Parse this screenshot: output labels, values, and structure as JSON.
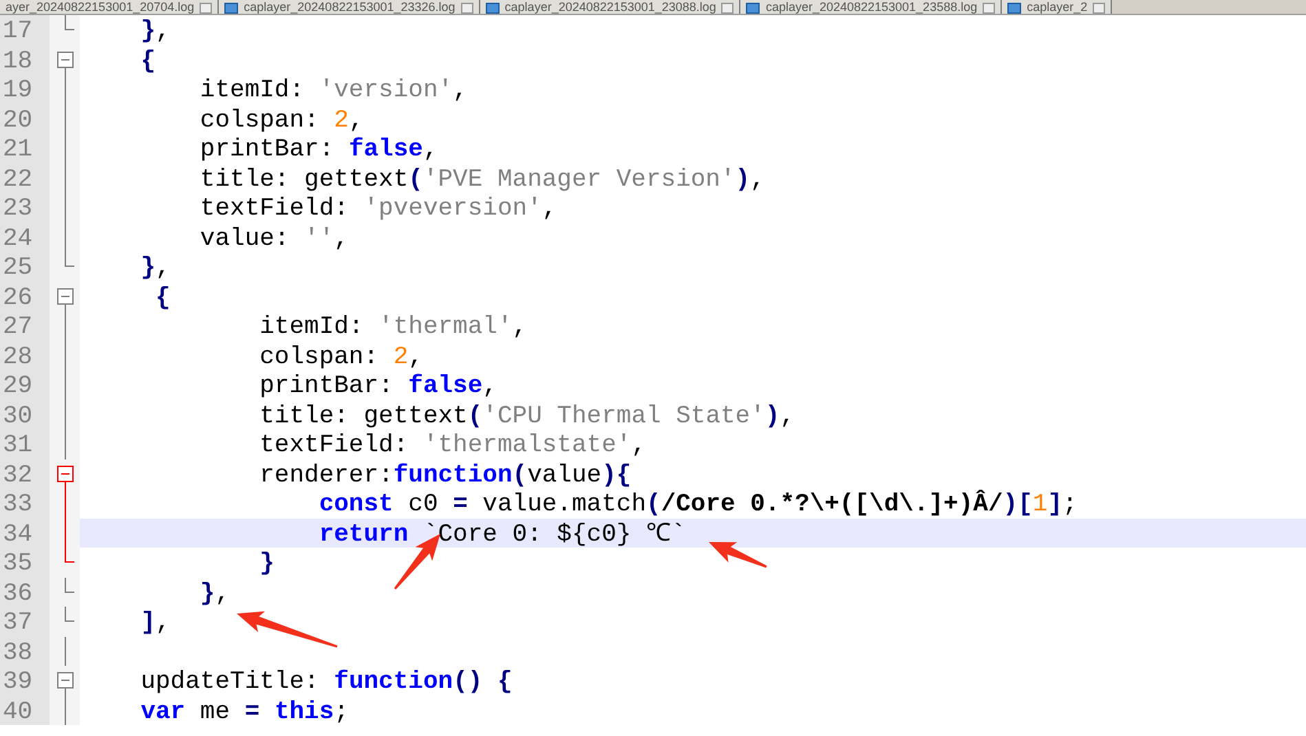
{
  "tabs": [
    {
      "label": "ayer_20240822153001_20704.log",
      "selected": false
    },
    {
      "label": "caplayer_20240822153001_23326.log",
      "selected": false
    },
    {
      "label": "caplayer_20240822153001_23088.log",
      "selected": false
    },
    {
      "label": "caplayer_20240822153001_23588.log",
      "selected": false
    },
    {
      "label": "caplayer_2",
      "selected": false
    }
  ],
  "lines": [
    {
      "number": "17",
      "kind": "end",
      "current": false,
      "tokens": [
        {
          "kind": "op",
          "text": "    }"
        },
        {
          "kind": "text",
          "text": ","
        }
      ]
    },
    {
      "number": "18",
      "kind": "box",
      "current": false,
      "tokens": [
        {
          "kind": "op",
          "text": "    {"
        }
      ]
    },
    {
      "number": "19",
      "kind": "line",
      "current": false,
      "tokens": [
        {
          "kind": "text",
          "text": "        itemId: "
        },
        {
          "kind": "string",
          "text": "'version'"
        },
        {
          "kind": "text",
          "text": ","
        }
      ]
    },
    {
      "number": "20",
      "kind": "line",
      "current": false,
      "tokens": [
        {
          "kind": "text",
          "text": "        colspan: "
        },
        {
          "kind": "number",
          "text": "2"
        },
        {
          "kind": "text",
          "text": ","
        }
      ]
    },
    {
      "number": "21",
      "kind": "line",
      "current": false,
      "tokens": [
        {
          "kind": "text",
          "text": "        printBar: "
        },
        {
          "kind": "keyword",
          "text": "false"
        },
        {
          "kind": "text",
          "text": ","
        }
      ]
    },
    {
      "number": "22",
      "kind": "line",
      "current": false,
      "tokens": [
        {
          "kind": "text",
          "text": "        title: gettext"
        },
        {
          "kind": "op",
          "text": "("
        },
        {
          "kind": "string",
          "text": "'PVE Manager Version'"
        },
        {
          "kind": "op",
          "text": ")"
        },
        {
          "kind": "text",
          "text": ","
        }
      ]
    },
    {
      "number": "23",
      "kind": "line",
      "current": false,
      "tokens": [
        {
          "kind": "text",
          "text": "        textField: "
        },
        {
          "kind": "string",
          "text": "'pveversion'"
        },
        {
          "kind": "text",
          "text": ","
        }
      ]
    },
    {
      "number": "24",
      "kind": "line",
      "current": false,
      "tokens": [
        {
          "kind": "text",
          "text": "        value: "
        },
        {
          "kind": "string",
          "text": "''"
        },
        {
          "kind": "text",
          "text": ","
        }
      ]
    },
    {
      "number": "25",
      "kind": "end",
      "current": false,
      "tokens": [
        {
          "kind": "op",
          "text": "    }"
        },
        {
          "kind": "text",
          "text": ","
        }
      ]
    },
    {
      "number": "26",
      "kind": "box",
      "current": false,
      "tokens": [
        {
          "kind": "op",
          "text": "     {"
        }
      ]
    },
    {
      "number": "27",
      "kind": "line",
      "current": false,
      "tokens": [
        {
          "kind": "text",
          "text": "            itemId: "
        },
        {
          "kind": "string",
          "text": "'thermal'"
        },
        {
          "kind": "text",
          "text": ","
        }
      ]
    },
    {
      "number": "28",
      "kind": "line",
      "current": false,
      "tokens": [
        {
          "kind": "text",
          "text": "            colspan: "
        },
        {
          "kind": "number",
          "text": "2"
        },
        {
          "kind": "text",
          "text": ","
        }
      ]
    },
    {
      "number": "29",
      "kind": "line",
      "current": false,
      "tokens": [
        {
          "kind": "text",
          "text": "            printBar: "
        },
        {
          "kind": "keyword",
          "text": "false"
        },
        {
          "kind": "text",
          "text": ","
        }
      ]
    },
    {
      "number": "30",
      "kind": "line",
      "current": false,
      "tokens": [
        {
          "kind": "text",
          "text": "            title: gettext"
        },
        {
          "kind": "op",
          "text": "("
        },
        {
          "kind": "string",
          "text": "'CPU Thermal State'"
        },
        {
          "kind": "op",
          "text": ")"
        },
        {
          "kind": "text",
          "text": ","
        }
      ]
    },
    {
      "number": "31",
      "kind": "line",
      "current": false,
      "tokens": [
        {
          "kind": "text",
          "text": "            textField: "
        },
        {
          "kind": "string",
          "text": "'thermalstate'"
        },
        {
          "kind": "text",
          "text": ","
        }
      ]
    },
    {
      "number": "32",
      "kind": "box-red",
      "current": false,
      "tokens": [
        {
          "kind": "text",
          "text": "            renderer:"
        },
        {
          "kind": "keyword",
          "text": "function"
        },
        {
          "kind": "op",
          "text": "("
        },
        {
          "kind": "text",
          "text": "value"
        },
        {
          "kind": "op",
          "text": "){"
        }
      ]
    },
    {
      "number": "33",
      "kind": "line-red",
      "current": false,
      "tokens": [
        {
          "kind": "keyword",
          "text": "                const"
        },
        {
          "kind": "text",
          "text": " c0 "
        },
        {
          "kind": "op",
          "text": "="
        },
        {
          "kind": "text",
          "text": " value.match"
        },
        {
          "kind": "op",
          "text": "("
        },
        {
          "kind": "regex",
          "text": "/Core 0.*?\\+([\\d\\.]+)Â/"
        },
        {
          "kind": "op",
          "text": ")["
        },
        {
          "kind": "number",
          "text": "1"
        },
        {
          "kind": "op",
          "text": "]"
        },
        {
          "kind": "text",
          "text": ";"
        }
      ]
    },
    {
      "number": "34",
      "kind": "line-red",
      "current": true,
      "tokens": [
        {
          "kind": "keyword",
          "text": "                return"
        },
        {
          "kind": "text",
          "text": " `Core 0: ${c0} ℃`"
        }
      ]
    },
    {
      "number": "35",
      "kind": "end-red",
      "current": false,
      "tokens": [
        {
          "kind": "op",
          "text": "            }"
        }
      ]
    },
    {
      "number": "36",
      "kind": "end",
      "current": false,
      "tokens": [
        {
          "kind": "op",
          "text": "        }"
        },
        {
          "kind": "text",
          "text": ","
        }
      ]
    },
    {
      "number": "37",
      "kind": "end",
      "current": false,
      "tokens": [
        {
          "kind": "op",
          "text": "    ]"
        },
        {
          "kind": "text",
          "text": ","
        }
      ]
    },
    {
      "number": "38",
      "kind": "line",
      "current": false
    },
    {
      "number": "39",
      "kind": "box",
      "current": false,
      "tokens": [
        {
          "kind": "text",
          "text": "    updateTitle: "
        },
        {
          "kind": "keyword",
          "text": "function"
        },
        {
          "kind": "op",
          "text": "() {"
        }
      ]
    },
    {
      "number": "40",
      "kind": "line",
      "current": false,
      "tokens": [
        {
          "kind": "keyword",
          "text": "    var"
        },
        {
          "kind": "text",
          "text": " me "
        },
        {
          "kind": "op",
          "text": "= "
        },
        {
          "kind": "keyword",
          "text": "this"
        },
        {
          "kind": "text",
          "text": ";"
        }
      ]
    }
  ]
}
